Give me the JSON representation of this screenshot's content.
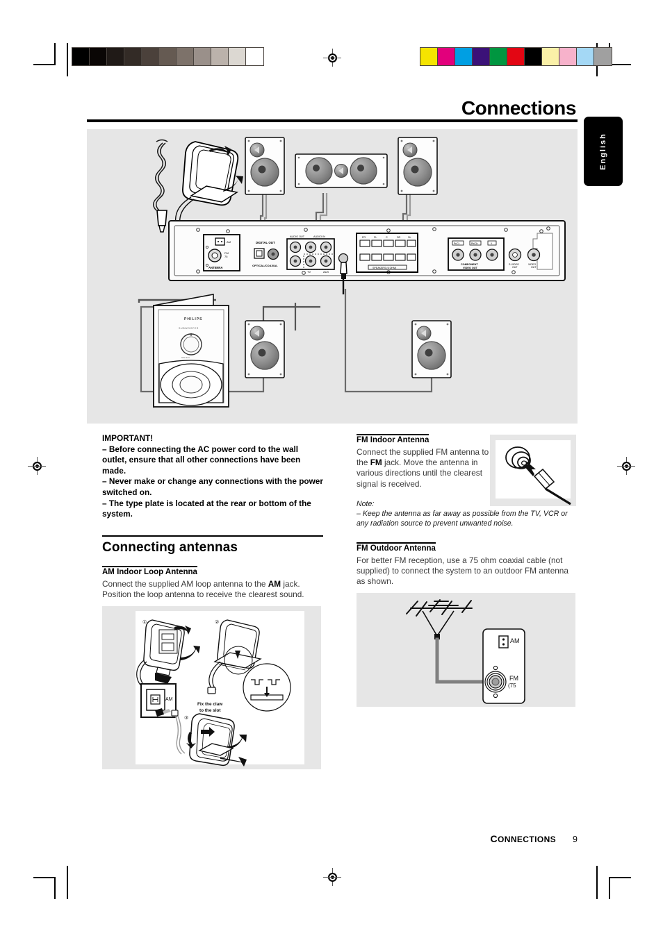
{
  "header": {
    "title": "Connections",
    "language_tab": "English"
  },
  "footer": {
    "section_first_letter": "C",
    "section_rest": "ONNECTIONS",
    "page_number": "9"
  },
  "calibration": {
    "gray_strip": [
      "#000000",
      "#0a0605",
      "#201a17",
      "#332b26",
      "#4b413b",
      "#655a52",
      "#7d726a",
      "#9a908a",
      "#bbb2ab",
      "#dcd8d2",
      "#ffffff"
    ],
    "color_strip": [
      "#f5e400",
      "#e2007c",
      "#009fe3",
      "#3b1178",
      "#009640",
      "#e30613",
      "#000000",
      "#faf0a8",
      "#f7b2cb",
      "#a4d8f5",
      "#a0a0a0"
    ]
  },
  "hero": {
    "caption_brand": "PHILIPS",
    "subwoofer_label": "SUBWOOFER",
    "rear_panel": {
      "antenna_block_label": "ANTENNA",
      "fm_jack_label": "FM 75",
      "am_jack_label": "AM",
      "digital_out_label": "DIGITAL OUT",
      "optical_coaxial_label": "OPTICAL/COAXIAL",
      "audio_out_label": "AUDIO OUT",
      "audio_in_label": "AUDIO IN",
      "tv_label": "TV",
      "aux_label": "AUX",
      "speaker_block_label": "SPEAKERS (6 OHM)",
      "speaker_terminals": [
        "FR",
        "FL",
        "C",
        "SR",
        "SL"
      ],
      "component_label": "COMPONENT VIDEO OUT",
      "component_jacks": [
        "Pr/Cr",
        "Pb/Cb",
        "Y"
      ],
      "svideo_label": "S-VIDEO OUT",
      "video_label": "VIDEO OUT"
    }
  },
  "left_column": {
    "important_heading": "IMPORTANT!",
    "important_items": [
      "–  Before connecting the AC power cord to the wall outlet, ensure that all other connections have been made.",
      "–  Never make or change any connections with the power switched on.",
      "–  The type plate is located at the rear or bottom of the system."
    ],
    "section_title": "Connecting antennas",
    "am": {
      "heading": "AM Indoor Loop Antenna",
      "body_before": "Connect the supplied AM loop antenna to the ",
      "body_bold": "AM",
      "body_after": " jack.  Position the loop antenna to receive the clearest sound.",
      "figure": {
        "step1": "1",
        "step2": "2",
        "step3": "3",
        "claw_note_line1": "Fix the claw",
        "claw_note_line2": "to the slot",
        "jack_label": "AM"
      }
    }
  },
  "right_column": {
    "fm_indoor": {
      "heading": "FM Indoor Antenna",
      "body_before": "Connect the supplied FM antenna to the ",
      "body_bold": "FM",
      "body_after": " jack. Move the antenna in various directions until the clearest signal is received."
    },
    "note": {
      "label": "Note:",
      "text": "–  Keep the antenna as far away as possible from the TV, VCR or any radiation source to prevent unwanted noise."
    },
    "fm_outdoor": {
      "heading": "FM Outdoor Antenna",
      "body": "For better FM reception, use a 75 ohm coaxial cable (not supplied) to connect the system to an outdoor FM antenna as shown.",
      "figure": {
        "am_label": "AM",
        "fm_label": "FM",
        "fm_ohm_label": "(75"
      }
    }
  }
}
